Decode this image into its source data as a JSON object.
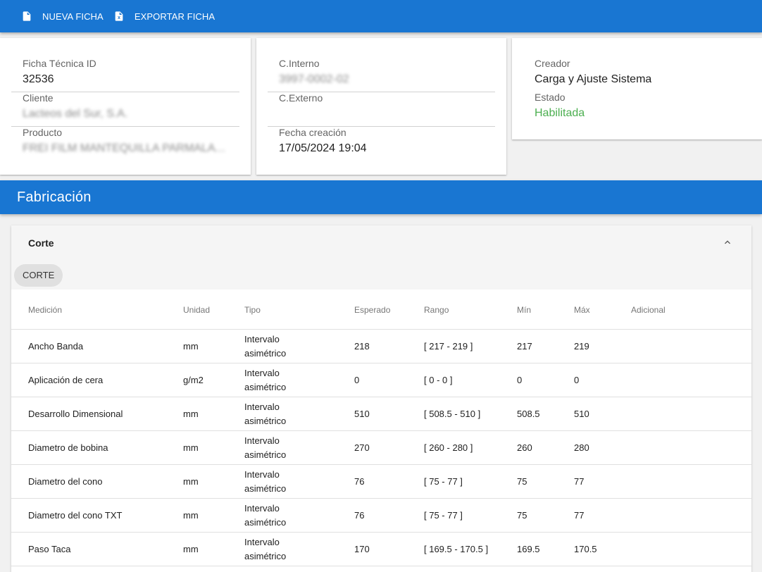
{
  "toolbar": {
    "new_label": "NUEVA FICHA",
    "export_label": "EXPORTAR FICHA"
  },
  "card1": {
    "id_label": "Ficha Técnica ID",
    "id_value": "32536",
    "client_label": "Cliente",
    "client_value": "Lacteos del Sur, S.A.",
    "product_label": "Producto",
    "product_value": "FREI FILM MANTEQUILLA PARMALAT..."
  },
  "card2": {
    "internal_label": "C.Interno",
    "internal_value": "3997-0002-02",
    "external_label": "C.Externo",
    "external_value": "",
    "date_label": "Fecha creación",
    "date_value": "17/05/2024 19:04"
  },
  "card3": {
    "creator_label": "Creador",
    "creator_value": "Carga y Ajuste Sistema",
    "status_label": "Estado",
    "status_value": "Habilitada",
    "status_color": "#4caf50"
  },
  "section": {
    "title": "Fabricación"
  },
  "panel": {
    "title": "Corte",
    "chip_label": "CORTE"
  },
  "table": {
    "headers": {
      "medicion": "Medición",
      "unidad": "Unidad",
      "tipo": "Tipo",
      "esperado": "Esperado",
      "rango": "Rango",
      "min": "Mín",
      "max": "Máx",
      "adicional": "Adicional"
    },
    "rows": [
      {
        "medicion": "Ancho Banda",
        "unidad": "mm",
        "tipo": "Intervalo asimétrico",
        "esperado": "218",
        "rango": "[ 217 - 219 ]",
        "min": "217",
        "max": "219",
        "adicional": ""
      },
      {
        "medicion": "Aplicación de cera",
        "unidad": "g/m2",
        "tipo": "Intervalo asimétrico",
        "esperado": "0",
        "rango": "[ 0 - 0 ]",
        "min": "0",
        "max": "0",
        "adicional": ""
      },
      {
        "medicion": "Desarrollo Dimensional",
        "unidad": "mm",
        "tipo": "Intervalo asimétrico",
        "esperado": "510",
        "rango": "[ 508.5 - 510 ]",
        "min": "508.5",
        "max": "510",
        "adicional": ""
      },
      {
        "medicion": "Diametro de bobina",
        "unidad": "mm",
        "tipo": "Intervalo asimétrico",
        "esperado": "270",
        "rango": "[ 260 - 280 ]",
        "min": "260",
        "max": "280",
        "adicional": ""
      },
      {
        "medicion": "Diametro del cono",
        "unidad": "mm",
        "tipo": "Intervalo asimétrico",
        "esperado": "76",
        "rango": "[ 75 - 77 ]",
        "min": "75",
        "max": "77",
        "adicional": ""
      },
      {
        "medicion": "Diametro del cono TXT",
        "unidad": "mm",
        "tipo": "Intervalo asimétrico",
        "esperado": "76",
        "rango": "[ 75 - 77 ]",
        "min": "75",
        "max": "77",
        "adicional": ""
      },
      {
        "medicion": "Paso Taca",
        "unidad": "mm",
        "tipo": "Intervalo asimétrico",
        "esperado": "170",
        "rango": "[ 169.5 - 170.5 ]",
        "min": "169.5",
        "max": "170.5",
        "adicional": ""
      },
      {
        "medicion": "",
        "unidad": "",
        "tipo": "",
        "esperado": "",
        "rango": "",
        "min": "",
        "max": "",
        "adicional": ""
      }
    ]
  },
  "colors": {
    "primary": "#1976d2",
    "success": "#4caf50"
  }
}
